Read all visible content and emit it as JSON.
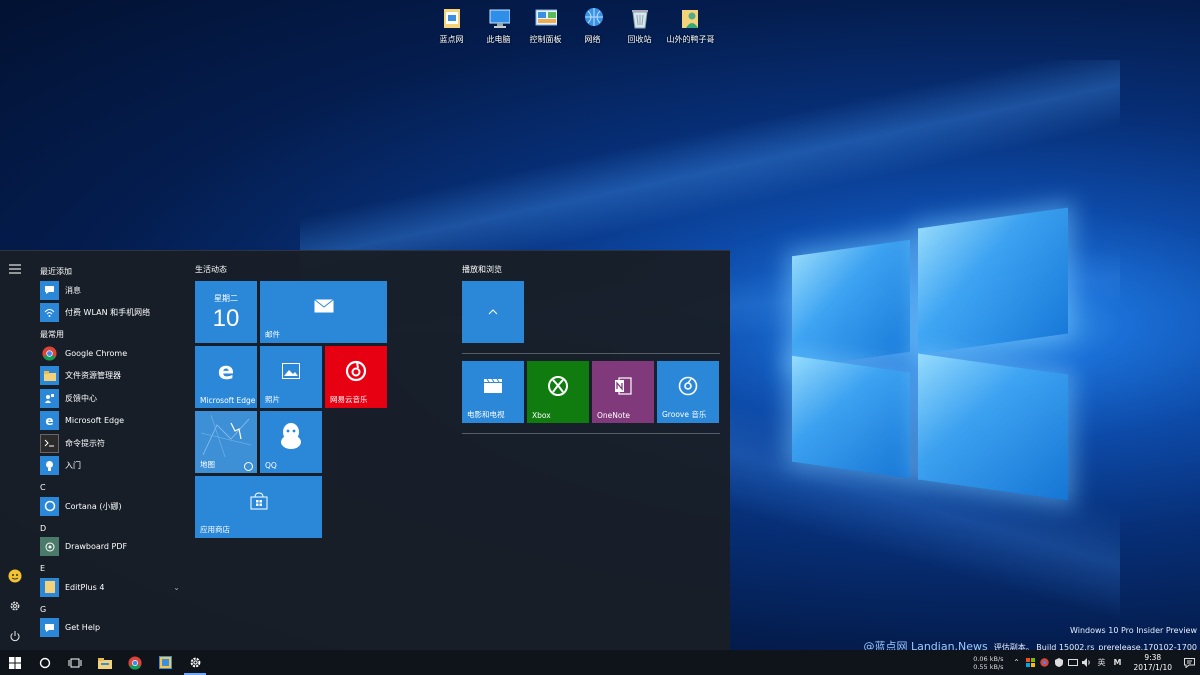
{
  "desktop": {
    "icons": [
      {
        "label": "蓝点网",
        "icon": "folder-icon"
      },
      {
        "label": "此电脑",
        "icon": "computer-icon"
      },
      {
        "label": "控制面板",
        "icon": "control-panel-icon"
      },
      {
        "label": "网络",
        "icon": "network-icon"
      },
      {
        "label": "回收站",
        "icon": "recycle-bin-icon"
      },
      {
        "label": "山外的鸭子哥",
        "icon": "user-folder-icon"
      }
    ],
    "watermark": {
      "brand": "@蓝点网 Landian.News",
      "line1": "Windows 10 Pro Insider Preview",
      "line2": "评估副本。 Build 15002.rs_prerelease.170102-1700"
    }
  },
  "start_menu": {
    "app_list": {
      "recent_header": "最近添加",
      "recent": [
        {
          "label": "消息",
          "icon": "message-icon",
          "color": "#2b88d8"
        },
        {
          "label": "付费 WLAN 和手机网络",
          "icon": "wlan-icon",
          "color": "#2b88d8"
        }
      ],
      "frequent_header": "最常用",
      "frequent": [
        {
          "label": "Google Chrome",
          "icon": "chrome-icon",
          "color": ""
        },
        {
          "label": "文件资源管理器",
          "icon": "file-explorer-icon",
          "color": "#2b88d8"
        },
        {
          "label": "反馈中心",
          "icon": "feedback-icon",
          "color": "#2b88d8"
        },
        {
          "label": "Microsoft Edge",
          "icon": "edge-icon",
          "color": "#2b88d8"
        },
        {
          "label": "命令提示符",
          "icon": "cmd-icon",
          "color": "#2b2b2b"
        },
        {
          "label": "入门",
          "icon": "tips-icon",
          "color": "#2b88d8"
        }
      ],
      "letters": [
        {
          "letter": "C",
          "apps": [
            {
              "label": "Cortana (小娜)",
              "icon": "cortana-icon",
              "color": "#2b88d8"
            }
          ]
        },
        {
          "letter": "D",
          "apps": [
            {
              "label": "Drawboard PDF",
              "icon": "drawboard-icon",
              "color": "#4a7a6a"
            }
          ]
        },
        {
          "letter": "E",
          "apps": [
            {
              "label": "EditPlus 4",
              "icon": "editplus-folder-icon",
              "color": "#2b88d8"
            }
          ]
        },
        {
          "letter": "G",
          "apps": [
            {
              "label": "Get Help",
              "icon": "help-icon",
              "color": "#2b88d8"
            }
          ]
        }
      ]
    },
    "group1": {
      "title": "生活动态",
      "calendar_day": "星期二",
      "calendar_date": "10",
      "tiles": {
        "mail": "邮件",
        "edge": "Microsoft Edge",
        "photos": "照片",
        "music163": "网易云音乐",
        "maps": "地图",
        "qq": "QQ",
        "store": "应用商店"
      }
    },
    "group2": {
      "title": "播放和浏览",
      "tiles": {
        "movies": "电影和电视",
        "xbox": "Xbox",
        "onenote": "OneNote",
        "groove": "Groove 音乐"
      }
    }
  },
  "taskbar": {
    "net_up": "0.06 kB/s",
    "net_down": "0.55 kB/s",
    "ime": "英",
    "ime_mode": "M",
    "time": "9:38",
    "date": "2017/1/10"
  },
  "colors": {
    "accent": "#2b88d8",
    "netease": "#e60012",
    "xbox": "#107c10",
    "onenote": "#80397b"
  }
}
